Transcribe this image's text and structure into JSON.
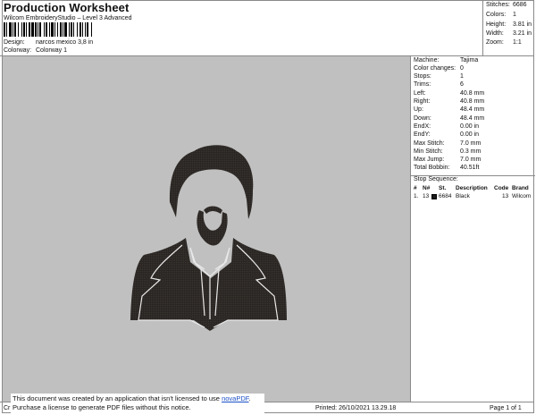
{
  "header": {
    "title": "Production Worksheet",
    "subtitle": "Wilcom EmbroideryStudio – Level 3 Advanced",
    "design_label": "Design:",
    "design_value": "narcos mexico 3,8 in",
    "colorway_label": "Colorway:",
    "colorway_value": "Colorway 1"
  },
  "stats": [
    {
      "label": "Stitches:",
      "value": "6686"
    },
    {
      "label": "Colors:",
      "value": "1"
    },
    {
      "label": "Height:",
      "value": "3.81 in"
    },
    {
      "label": "Width:",
      "value": "3.21 in"
    },
    {
      "label": "Zoom:",
      "value": "1:1"
    }
  ],
  "details": [
    {
      "label": "Machine:",
      "value": "Tajima"
    },
    {
      "label": "Color changes:",
      "value": "0"
    },
    {
      "label": "Stops:",
      "value": "1"
    },
    {
      "label": "Trims:",
      "value": "6"
    },
    {
      "label": "Left:",
      "value": "40.8 mm"
    },
    {
      "label": "Right:",
      "value": "40.8 mm"
    },
    {
      "label": "Up:",
      "value": "48.4 mm"
    },
    {
      "label": "Down:",
      "value": "48.4 mm"
    },
    {
      "label": "EndX:",
      "value": "0.00 in"
    },
    {
      "label": "EndY:",
      "value": "0.00 in"
    },
    {
      "label": "Max Stitch:",
      "value": "7.0 mm"
    },
    {
      "label": "Min Stitch:",
      "value": "0.3 mm"
    },
    {
      "label": "Max Jump:",
      "value": "7.0 mm"
    },
    {
      "label": "Total Bobbin:",
      "value": "40.51ft"
    }
  ],
  "stop_sequence": {
    "title": "Stop Sequence:",
    "columns": [
      "#",
      "N#",
      "St.",
      "Description",
      "Code",
      "Brand"
    ],
    "rows": [
      {
        "num": "1.",
        "n": "13",
        "st": "6684",
        "description": "Black",
        "code": "13",
        "brand": "Wilcom",
        "color": "#1a1a1a"
      }
    ]
  },
  "footer": {
    "left": "Cr",
    "printed": "Printed: 26/10/2021 13.29.18",
    "page": "Page 1 of 1"
  },
  "notice": {
    "line1": "This document was created by an application that isn't licensed to use",
    "link": "novaPDF",
    "line2": "Purchase a license to generate PDF files without this notice."
  },
  "colors": {
    "canvas_bg": "#c0c0c0",
    "thread": "#2a2623",
    "border": "#8a8a8a",
    "link": "#1a4fc6"
  }
}
